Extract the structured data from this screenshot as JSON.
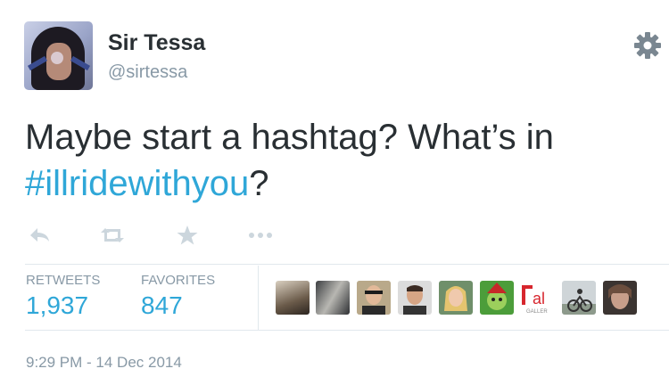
{
  "user": {
    "name": "Sir Tessa",
    "handle": "@sirtessa"
  },
  "tweet": {
    "text_line1": "Maybe start a hashtag? What’s in",
    "hashtag": "#illridewithyou",
    "text_end": "?"
  },
  "actions": [
    {
      "icon": "reply-icon"
    },
    {
      "icon": "retweet-icon"
    },
    {
      "icon": "favorite-star-icon"
    },
    {
      "icon": "more-dots-icon"
    }
  ],
  "stats": {
    "retweets_label": "RETWEETS",
    "retweets_value": "1,937",
    "favorites_label": "FAVORITES",
    "favorites_value": "847"
  },
  "favoriters": {
    "gallery_badge_text": "al",
    "gallery_badge_sub": "GALLER"
  },
  "timestamp": "9:29 PM - 14 Dec 2014",
  "colors": {
    "link": "#2fa7d8",
    "text": "#292f33",
    "muted": "#8899a6",
    "icon": "#ccd6dd",
    "divider": "#e1e8ed"
  }
}
